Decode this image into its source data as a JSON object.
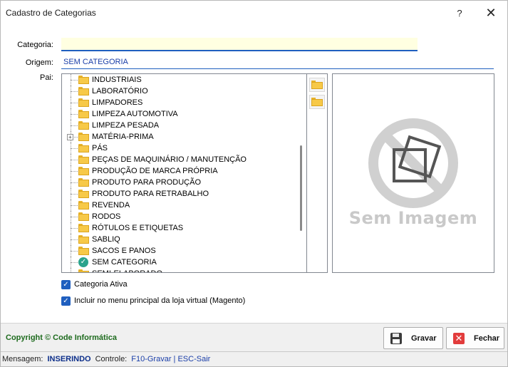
{
  "window": {
    "title": "Cadastro de Categorias",
    "help_label": "?",
    "close_label": "✕"
  },
  "form": {
    "categoria_label": "Categoria:",
    "categoria_value": "",
    "origem_label": "Origem:",
    "origem_value": "SEM CATEGORIA",
    "pai_label": "Pai:"
  },
  "tree": {
    "items": [
      {
        "label": "INDUSTRIAIS",
        "icon": "folder-icon"
      },
      {
        "label": "LABORATÓRIO",
        "icon": "folder-icon"
      },
      {
        "label": "LIMPADORES",
        "icon": "folder-icon"
      },
      {
        "label": "LIMPEZA AUTOMOTIVA",
        "icon": "folder-icon"
      },
      {
        "label": "LIMPEZA PESADA",
        "icon": "folder-icon"
      },
      {
        "label": "MATÉRIA-PRIMA",
        "icon": "folder-icon",
        "expandable": true
      },
      {
        "label": "PÁS",
        "icon": "folder-icon"
      },
      {
        "label": "PEÇAS DE MAQUINÁRIO / MANUTENÇÃO",
        "icon": "folder-icon"
      },
      {
        "label": "PRODUÇÃO DE MARCA PRÓPRIA",
        "icon": "folder-icon"
      },
      {
        "label": "PRODUTO PARA PRODUÇÃO",
        "icon": "folder-icon"
      },
      {
        "label": "PRODUTO PARA RETRABALHO",
        "icon": "folder-icon"
      },
      {
        "label": "REVENDA",
        "icon": "folder-icon"
      },
      {
        "label": "RODOS",
        "icon": "folder-icon"
      },
      {
        "label": "RÓTULOS E ETIQUETAS",
        "icon": "folder-icon"
      },
      {
        "label": "SABLIQ",
        "icon": "folder-icon"
      },
      {
        "label": "SACOS E PANOS",
        "icon": "folder-icon"
      },
      {
        "label": "SEM CATEGORIA",
        "icon": "check-circle-icon"
      },
      {
        "label": "SEMI-ELABORADO",
        "icon": "folder-icon"
      }
    ]
  },
  "image_panel": {
    "placeholder_text": "Sem Imagem"
  },
  "options": {
    "categoria_ativa_label": "Categoria Ativa",
    "categoria_ativa_checked": true,
    "menu_principal_label": "Incluir no menu principal da loja virtual (Magento)",
    "menu_principal_checked": true
  },
  "footer": {
    "copyright": "Copyright © Code Informática",
    "gravar_label": "Gravar",
    "fechar_label": "Fechar"
  },
  "statusbar": {
    "mensagem_label": "Mensagem:",
    "mensagem_value": "INSERINDO",
    "controle_label": "Controle:",
    "controle_value": "F10-Gravar | ESC-Sair"
  },
  "colors": {
    "accent": "#1f5fbf",
    "folder": "#f7c948",
    "check": "#2aa38c",
    "copyright": "#1e6b1e",
    "close_red": "#e23c3c"
  }
}
